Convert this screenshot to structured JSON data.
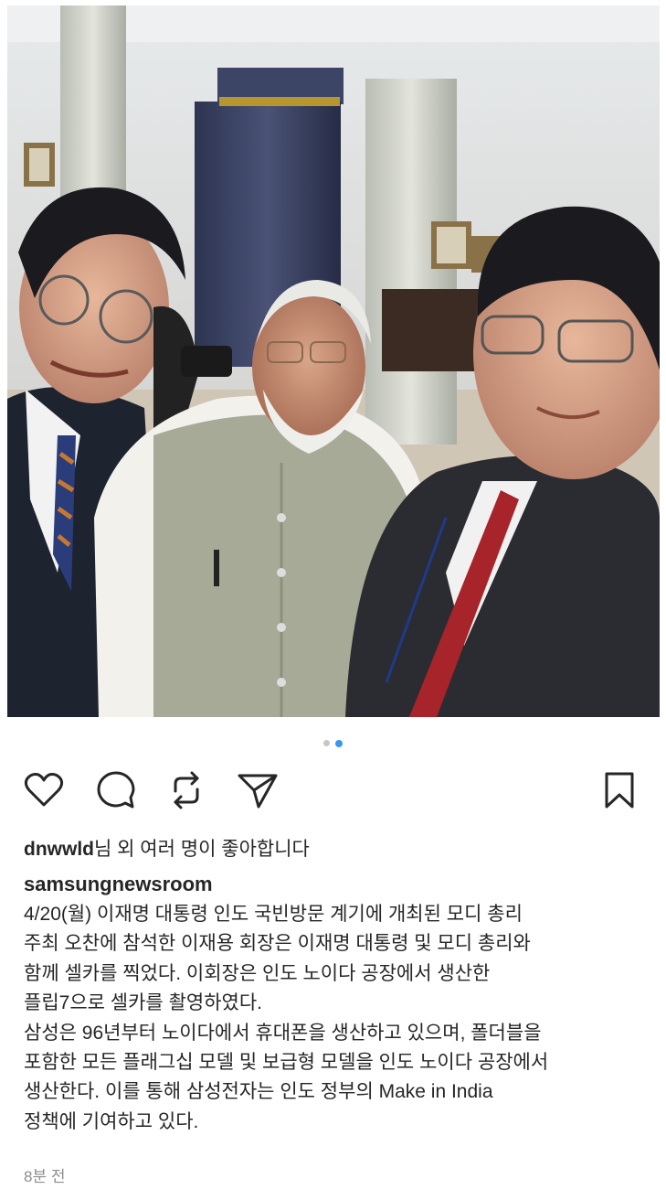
{
  "post": {
    "image": {
      "description_icon": "selfie-photo",
      "carousel_count": 2,
      "carousel_active": 2
    },
    "actions": {
      "like_icon": "heart-icon",
      "comment_icon": "comment-icon",
      "repost_icon": "repost-icon",
      "share_icon": "send-icon",
      "save_icon": "bookmark-icon"
    },
    "likes": {
      "user": "dnwwld",
      "text": "님 외 여러 명이 좋아합니다"
    },
    "account": "samsungnewsroom",
    "caption": [
      "4/20(월) 이재명 대통령 인도 국빈방문 계기에 개최된 모디 총리",
      "주최 오찬에 참석한 이재용 회장은 이재명 대통령 및 모디 총리와",
      "함께 셀카를 찍었다. 이회장은 인도 노이다 공장에서 생산한",
      "플립7으로 셀카를 촬영하였다.",
      "삼성은 96년부터 노이다에서 휴대폰을 생산하고 있으며, 폴더블을",
      "포함한 모든 플래그십 모델 및 보급형 모델을 인도 노이다 공장에서",
      "생산한다. 이를 통해 삼성전자는 인도 정부의 Make in India",
      "정책에 기여하고 있다."
    ],
    "time": "8분 전",
    "colors": {
      "accent": "#3897f0",
      "text": "#262626",
      "muted": "#8e8e8e"
    }
  }
}
